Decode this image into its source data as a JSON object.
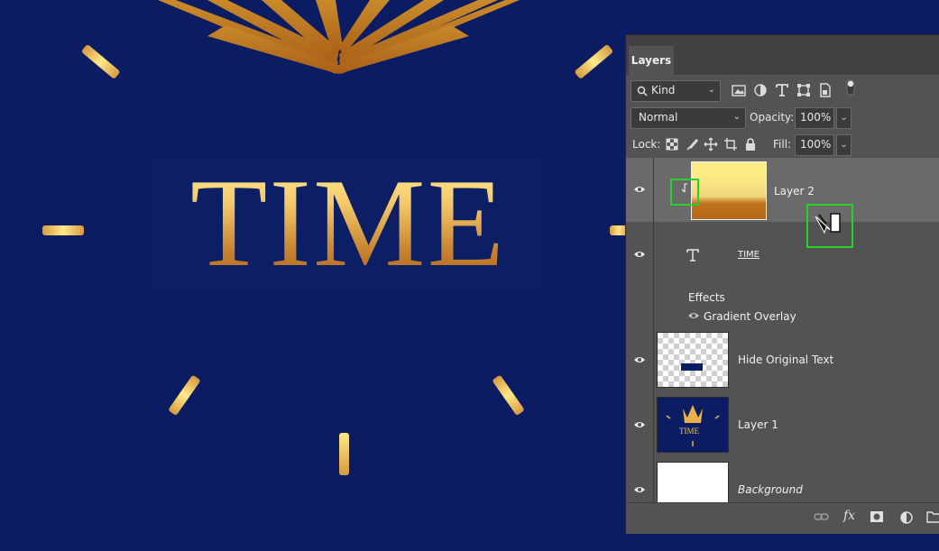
{
  "canvas": {
    "title_text": "TIME",
    "colors": {
      "background": "#0b1c63",
      "gold_light": "#fff09a",
      "gold_dark": "#a75c17"
    }
  },
  "layers_panel": {
    "tab_label": "Layers",
    "filter_kind_label": "Kind",
    "blend_mode": "Normal",
    "opacity_label": "Opacity:",
    "opacity_value": "100%",
    "lock_label": "Lock:",
    "fill_label": "Fill:",
    "fill_value": "100%",
    "layers": [
      {
        "name": "Layer 2",
        "selected": true,
        "clipping_mask": true
      },
      {
        "name": "TIME",
        "type": "text",
        "effects_label": "Effects",
        "effect_name": "Gradient Overlay"
      },
      {
        "name": "Hide Original Text"
      },
      {
        "name": "Layer 1"
      },
      {
        "name": "Background"
      }
    ],
    "layer1_thumb_text": "TIME",
    "icons": {
      "filter": [
        "image-filter-icon",
        "adjustment-filter-icon",
        "type-filter-icon",
        "shape-filter-icon",
        "smartobject-filter-icon",
        "filter-toggle-icon"
      ],
      "lock": [
        "lock-transparent-icon",
        "lock-image-icon",
        "lock-position-icon",
        "lock-artboard-icon",
        "lock-all-icon"
      ],
      "bottom": [
        "link-icon",
        "fx-icon",
        "mask-icon",
        "adjustment-icon",
        "folder-icon"
      ]
    },
    "bottom_fx_label": "fx"
  }
}
